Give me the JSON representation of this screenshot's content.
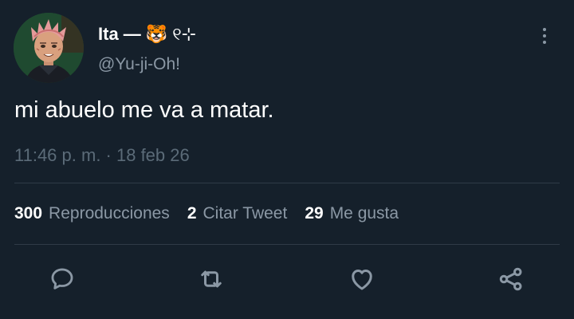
{
  "tweet": {
    "display_name": "Ita —",
    "name_emoji": "🐯",
    "name_suffix": "୧⊹",
    "handle": "@Yu-ji-Oh!",
    "text": "mi abuelo me va a matar.",
    "timestamp": "11:46 p. m. · 18 feb 26"
  },
  "stats": [
    {
      "count": "300",
      "label": "Reproducciones"
    },
    {
      "count": "2",
      "label": "Citar Tweet"
    },
    {
      "count": "29",
      "label": "Me gusta"
    }
  ],
  "icons": {
    "more": "more-vertical-icon",
    "reply": "reply-icon",
    "retweet": "retweet-icon",
    "like": "heart-icon",
    "share": "share-icon"
  },
  "colors": {
    "background": "#15202b",
    "secondary_text": "#8b98a5",
    "divider": "#2f3b47"
  }
}
